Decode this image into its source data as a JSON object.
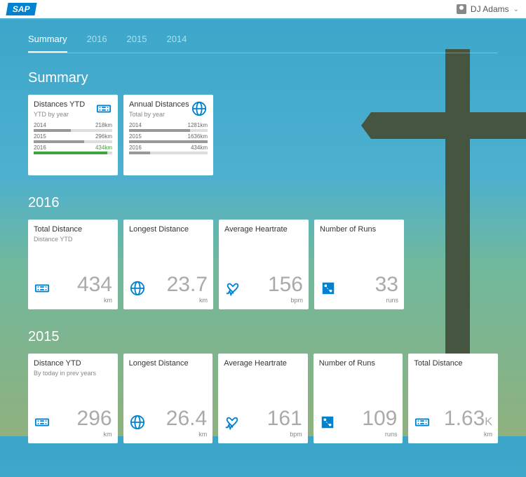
{
  "header": {
    "logo": "SAP",
    "user": "DJ Adams"
  },
  "tabs": [
    {
      "label": "Summary",
      "active": true
    },
    {
      "label": "2016",
      "active": false
    },
    {
      "label": "2015",
      "active": false
    },
    {
      "label": "2014",
      "active": false
    }
  ],
  "sections": [
    {
      "title": "Summary",
      "tiles": [
        {
          "type": "barlist",
          "title": "Distances YTD",
          "subtitle": "YTD by year",
          "icon": "card",
          "rows": [
            {
              "label": "2014",
              "value": "218km",
              "pct": 47
            },
            {
              "label": "2015",
              "value": "296km",
              "pct": 64
            },
            {
              "label": "2016",
              "value": "434km",
              "pct": 94,
              "green": true
            }
          ]
        },
        {
          "type": "barlist",
          "title": "Annual Distances",
          "subtitle": "Total by year",
          "icon": "globe",
          "rows": [
            {
              "label": "2014",
              "value": "1281km",
              "pct": 78
            },
            {
              "label": "2015",
              "value": "1636km",
              "pct": 100
            },
            {
              "label": "2016",
              "value": "434km",
              "pct": 27
            }
          ]
        }
      ]
    },
    {
      "title": "2016",
      "tiles": [
        {
          "type": "kpi",
          "title": "Total Distance",
          "subtitle": "Distance YTD",
          "icon": "card",
          "value": "434",
          "unit": "km"
        },
        {
          "type": "kpi",
          "title": "Longest Distance",
          "subtitle": "",
          "icon": "globe",
          "value": "23.7",
          "unit": "km"
        },
        {
          "type": "kpi",
          "title": "Average Heartrate",
          "subtitle": "",
          "icon": "heart",
          "value": "156",
          "unit": "bpm"
        },
        {
          "type": "kpi",
          "title": "Number of Runs",
          "subtitle": "",
          "icon": "route",
          "value": "33",
          "unit": "runs"
        }
      ]
    },
    {
      "title": "2015",
      "tiles": [
        {
          "type": "kpi",
          "title": "Distance YTD",
          "subtitle": "By today in prev years",
          "icon": "card",
          "value": "296",
          "unit": "km"
        },
        {
          "type": "kpi",
          "title": "Longest Distance",
          "subtitle": "",
          "icon": "globe",
          "value": "26.4",
          "unit": "km"
        },
        {
          "type": "kpi",
          "title": "Average Heartrate",
          "subtitle": "",
          "icon": "heart",
          "value": "161",
          "unit": "bpm"
        },
        {
          "type": "kpi",
          "title": "Number of Runs",
          "subtitle": "",
          "icon": "route",
          "value": "109",
          "unit": "runs"
        },
        {
          "type": "kpi",
          "title": "Total Distance",
          "subtitle": "",
          "icon": "card",
          "value": "1.63",
          "suffix": "K",
          "unit": "km"
        }
      ]
    }
  ],
  "chart_data": [
    {
      "type": "bar",
      "title": "Distances YTD",
      "ylabel": "YTD by year",
      "categories": [
        "2014",
        "2015",
        "2016"
      ],
      "values": [
        218,
        296,
        434
      ],
      "unit": "km"
    },
    {
      "type": "bar",
      "title": "Annual Distances",
      "ylabel": "Total by year",
      "categories": [
        "2014",
        "2015",
        "2016"
      ],
      "values": [
        1281,
        1636,
        434
      ],
      "unit": "km"
    }
  ]
}
